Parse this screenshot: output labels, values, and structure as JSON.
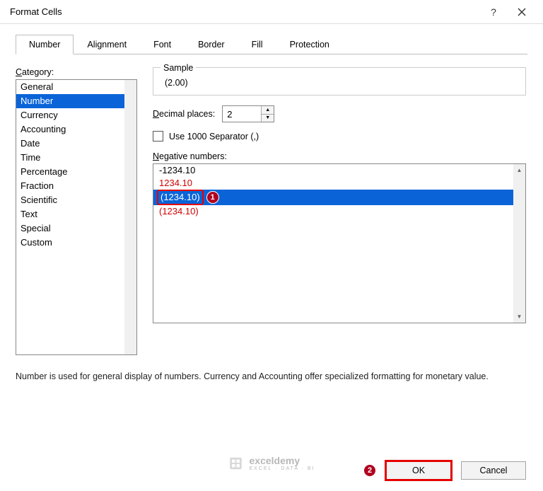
{
  "titlebar": {
    "title": "Format Cells",
    "help": "?",
    "close": "✕"
  },
  "tabs": [
    "Number",
    "Alignment",
    "Font",
    "Border",
    "Fill",
    "Protection"
  ],
  "active_tab_index": 0,
  "category": {
    "label_pre": "C",
    "label_post": "ategory:",
    "items": [
      "General",
      "Number",
      "Currency",
      "Accounting",
      "Date",
      "Time",
      "Percentage",
      "Fraction",
      "Scientific",
      "Text",
      "Special",
      "Custom"
    ],
    "selected_index": 1
  },
  "sample": {
    "legend": "Sample",
    "value": "(2.00)"
  },
  "decimal": {
    "label_pre": "D",
    "label_post": "ecimal places:",
    "value": "2"
  },
  "separator": {
    "label_pre": "U",
    "label_post": "se 1000 Separator (,)",
    "checked": false
  },
  "negative": {
    "label_pre": "N",
    "label_post": "egative numbers:",
    "items": [
      {
        "text": "-1234.10",
        "red": false
      },
      {
        "text": "1234.10",
        "red": true
      },
      {
        "text": "(1234.10)",
        "red": false,
        "selected": true,
        "boxed": true
      },
      {
        "text": "(1234.10)",
        "red": true
      }
    ]
  },
  "annotations": {
    "step1": "1",
    "step2": "2"
  },
  "description": "Number is used for general display of numbers.  Currency and Accounting offer specialized formatting for monetary value.",
  "buttons": {
    "ok": "OK",
    "cancel": "Cancel"
  },
  "watermark": {
    "name": "exceldemy",
    "sub": "EXCEL · DATA · BI"
  }
}
